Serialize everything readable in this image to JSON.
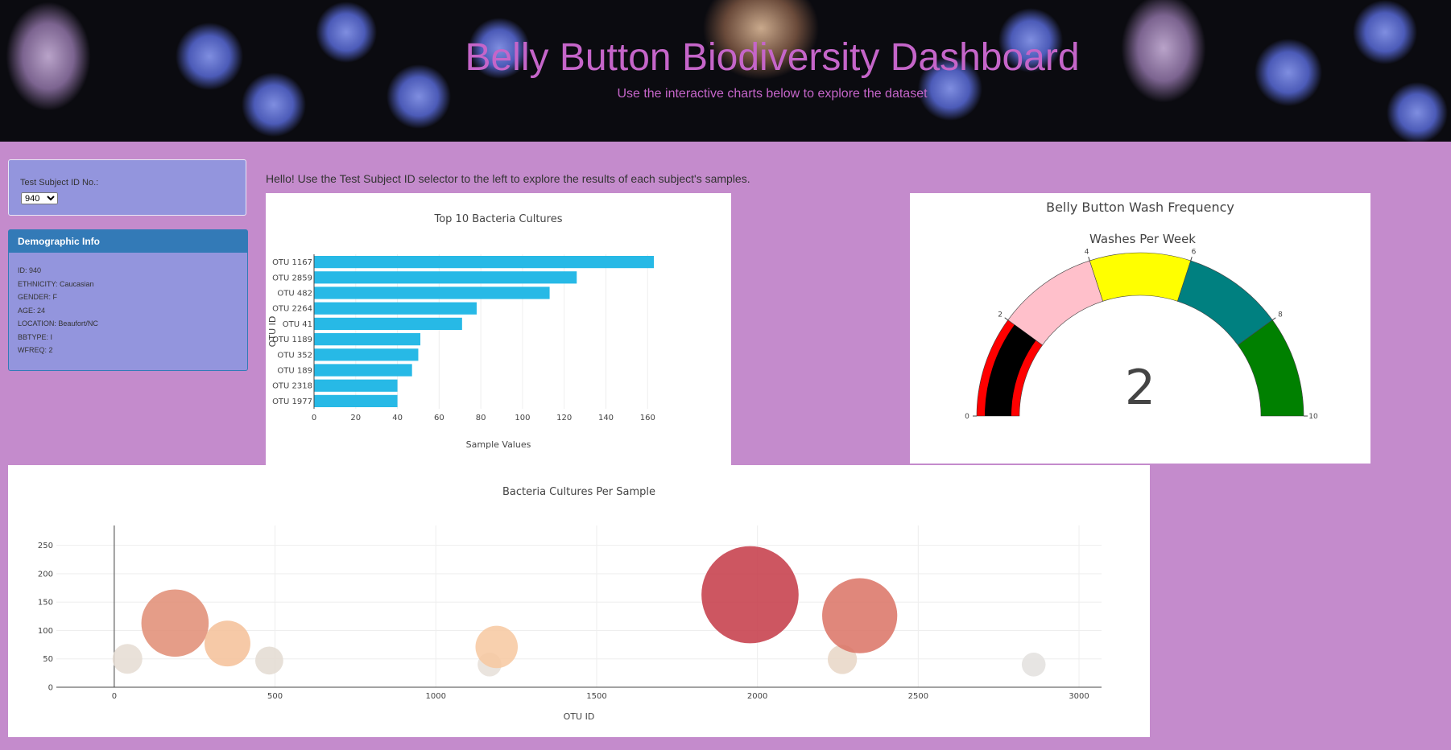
{
  "header": {
    "title": "Belly Button Biodiversity Dashboard",
    "subtitle": "Use the interactive charts below to explore the dataset"
  },
  "selector": {
    "label": "Test Subject ID No.:",
    "selected": "940"
  },
  "demographics": {
    "title": "Demographic Info",
    "items": [
      "ID: 940",
      "ETHNICITY: Caucasian",
      "GENDER: F",
      "AGE: 24",
      "LOCATION: Beaufort/NC",
      "BBTYPE: I",
      "WFREQ: 2"
    ]
  },
  "intro": "Hello! Use the Test Subject ID selector to the left to explore the results of each subject's samples.",
  "chart_data": [
    {
      "type": "bar",
      "orientation": "horizontal",
      "title": "Top 10 Bacteria Cultures",
      "xlabel": "Sample Values",
      "ylabel": "OTU ID",
      "categories": [
        "OTU 1167",
        "OTU 2859",
        "OTU 482",
        "OTU 2264",
        "OTU 41",
        "OTU 1189",
        "OTU 352",
        "OTU 189",
        "OTU 2318",
        "OTU 1977"
      ],
      "values": [
        163,
        126,
        113,
        78,
        71,
        51,
        50,
        47,
        40,
        40
      ],
      "xlim": [
        0,
        168
      ],
      "xticks": [
        0,
        20,
        40,
        60,
        80,
        100,
        120,
        140,
        160
      ],
      "color": "#27b9e6",
      "grid": true
    },
    {
      "type": "gauge",
      "title": "Belly Button Wash Frequency",
      "subtitle": "Washes Per Week",
      "value": 2,
      "range": [
        0,
        10
      ],
      "ticks": [
        0,
        2,
        4,
        6,
        8,
        10
      ],
      "steps": [
        {
          "range": [
            0,
            2
          ],
          "color": "#ff0000"
        },
        {
          "range": [
            2,
            4
          ],
          "color": "#ffc0cb"
        },
        {
          "range": [
            4,
            6
          ],
          "color": "#ffff00"
        },
        {
          "range": [
            6,
            8
          ],
          "color": "#008080"
        },
        {
          "range": [
            8,
            10
          ],
          "color": "#008000"
        }
      ],
      "bar_color": "#000000"
    },
    {
      "type": "scatter",
      "title": "Bacteria Cultures Per Sample",
      "xlabel": "OTU ID",
      "ylabel": "",
      "xlim": [
        -180,
        3070
      ],
      "ylim": [
        0,
        285
      ],
      "xticks": [
        0,
        500,
        1000,
        1500,
        2000,
        2500,
        3000
      ],
      "yticks": [
        0,
        50,
        100,
        150,
        200,
        250
      ],
      "grid": true,
      "points": [
        {
          "x": 41,
          "y": 50,
          "size": 50,
          "color": "#e5dcd2"
        },
        {
          "x": 189,
          "y": 113,
          "size": 113,
          "color": "#e08c73"
        },
        {
          "x": 352,
          "y": 77,
          "size": 77,
          "color": "#f5bf98"
        },
        {
          "x": 482,
          "y": 47,
          "size": 47,
          "color": "#e3dad1"
        },
        {
          "x": 1167,
          "y": 40,
          "size": 40,
          "color": "#e6dfd8"
        },
        {
          "x": 1189,
          "y": 71,
          "size": 71,
          "color": "#f7c8a0"
        },
        {
          "x": 1977,
          "y": 163,
          "size": 163,
          "color": "#c43845"
        },
        {
          "x": 2264,
          "y": 49,
          "size": 49,
          "color": "#e8d6c6"
        },
        {
          "x": 2318,
          "y": 126,
          "size": 126,
          "color": "#db7264"
        },
        {
          "x": 2859,
          "y": 40,
          "size": 40,
          "color": "#e3e0de"
        }
      ]
    }
  ]
}
